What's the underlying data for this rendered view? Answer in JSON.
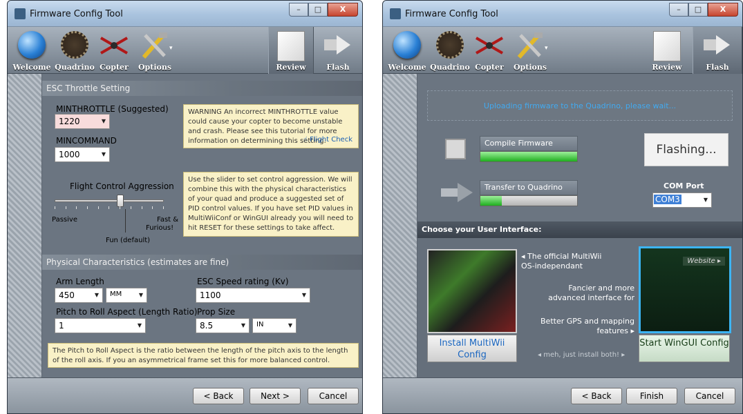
{
  "window": {
    "title": "Firmware Config Tool",
    "minimize": "–",
    "maximize": "□",
    "close": "X"
  },
  "toolbar": {
    "items": [
      {
        "label": "Welcome",
        "icon": "globe-icon"
      },
      {
        "label": "Quadrino",
        "icon": "board-icon"
      },
      {
        "label": "Copter",
        "icon": "copter-icon"
      },
      {
        "label": "Options",
        "icon": "tools-icon"
      }
    ],
    "options_caret": "▾",
    "review": "Review",
    "flash": "Flash"
  },
  "left": {
    "esc_section": "ESC Throttle Setting",
    "minthrottle_label": "MINTHROTTLE (Suggested)",
    "minthrottle_value": "1220",
    "mincommand_label": "MINCOMMAND",
    "mincommand_value": "1000",
    "warning": "WARNING  An incorrect MINTHROTTLE value could cause your copter to become unstable and crash. Please see this tutorial for more information on determining this setting.",
    "flight_check": "Flight Check",
    "aggression_label": "Flight Control Aggression",
    "aggression_level": 0.6,
    "passive": "Passive",
    "fast_furious_1": "Fast &",
    "fast_furious_2": "Furious!",
    "fun_default": "Fun (default)",
    "slider_note": "Use the slider to set control aggression. We will combine this with the physical characteristics of your quad and produce a suggested set of PID control values. If you have set PID values in MultiWiiConf or WinGUI already you will need to hit RESET for these settings to take affect.",
    "physical_section": "Physical Characteristics (estimates are fine)",
    "arm_length_label": "Arm Length",
    "arm_length_value": "450",
    "arm_unit": "MM",
    "esc_speed_label": "ESC Speed rating (Kv)",
    "esc_speed_value": "1100",
    "pitch_roll_label": "Pitch to Roll Aspect (Length Ratio)",
    "pitch_roll_value": "1",
    "prop_size_label": "Prop Size",
    "prop_size_value": "8.5",
    "prop_unit": "IN",
    "aspect_note": "The Pitch to Roll Aspect is the ratio between the length of the pitch axis to the length of the roll axis. If you an asymmetrical frame set this for more balanced control.",
    "buttons": {
      "back": "< Back",
      "next": "Next >",
      "cancel": "Cancel"
    }
  },
  "right": {
    "uploading": "Uploading firmware to the Quadrino, please wait...",
    "compile_label": "Compile Firmware",
    "compile_progress": 1.0,
    "transfer_label": "Transfer to Quadrino",
    "transfer_progress": 0.22,
    "flashing": "Flashing...",
    "com_port_label": "COM Port",
    "com_port_value": "COM3",
    "choose_ui": "Choose your User Interface:",
    "multiwii_desc": "◂ The official MultiWii OS-independant",
    "fancier": "Fancier and more advanced interface for",
    "better_gps": "Better GPS and mapping features ▸",
    "website": "Website ▸",
    "install_multiwii": "Install MultiWii Config",
    "start_wingui": "Start WinGUI Config",
    "meh": "◂ meh, just install both! ▸",
    "buttons": {
      "back": "< Back",
      "finish": "Finish",
      "cancel": "Cancel"
    }
  }
}
